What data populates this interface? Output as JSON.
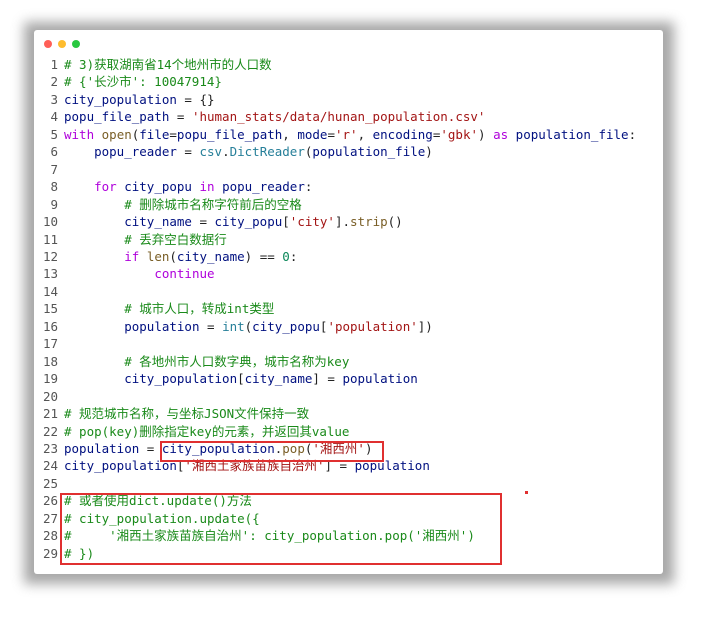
{
  "window": {
    "controls": [
      "close",
      "minimize",
      "maximize"
    ],
    "colors": {
      "close": "#ff5f57",
      "minimize": "#febc2e",
      "maximize": "#28c840"
    }
  },
  "code": {
    "lines": [
      {
        "num": "1",
        "tokens": [
          [
            "c",
            "# 3)获取湖南省14个地州市的人口数"
          ]
        ]
      },
      {
        "num": "2",
        "tokens": [
          [
            "c",
            "# {'长沙市': 10047914}"
          ]
        ]
      },
      {
        "num": "3",
        "tokens": [
          [
            "v",
            "city_population"
          ],
          [
            "p",
            " = {}"
          ]
        ]
      },
      {
        "num": "4",
        "tokens": [
          [
            "v",
            "popu_file_path"
          ],
          [
            "p",
            " = "
          ],
          [
            "s",
            "'human_stats/data/hunan_population.csv'"
          ]
        ]
      },
      {
        "num": "5",
        "tokens": [
          [
            "k",
            "with"
          ],
          [
            "p",
            " "
          ],
          [
            "f",
            "open"
          ],
          [
            "p",
            "("
          ],
          [
            "v",
            "file"
          ],
          [
            "p",
            "="
          ],
          [
            "v",
            "popu_file_path"
          ],
          [
            "p",
            ", "
          ],
          [
            "v",
            "mode"
          ],
          [
            "p",
            "="
          ],
          [
            "s",
            "'r'"
          ],
          [
            "p",
            ", "
          ],
          [
            "v",
            "encoding"
          ],
          [
            "p",
            "="
          ],
          [
            "s",
            "'gbk'"
          ],
          [
            "p",
            ") "
          ],
          [
            "k",
            "as"
          ],
          [
            "p",
            " "
          ],
          [
            "v",
            "population_file"
          ],
          [
            "p",
            ":"
          ]
        ]
      },
      {
        "num": "6",
        "tokens": [
          [
            "p",
            "    "
          ],
          [
            "v",
            "popu_reader"
          ],
          [
            "p",
            " = "
          ],
          [
            "t",
            "csv"
          ],
          [
            "p",
            "."
          ],
          [
            "t",
            "DictReader"
          ],
          [
            "p",
            "("
          ],
          [
            "v",
            "population_file"
          ],
          [
            "p",
            ")"
          ]
        ]
      },
      {
        "num": "7",
        "tokens": []
      },
      {
        "num": "8",
        "tokens": [
          [
            "p",
            "    "
          ],
          [
            "k",
            "for"
          ],
          [
            "p",
            " "
          ],
          [
            "v",
            "city_popu"
          ],
          [
            "p",
            " "
          ],
          [
            "k",
            "in"
          ],
          [
            "p",
            " "
          ],
          [
            "v",
            "popu_reader"
          ],
          [
            "p",
            ":"
          ]
        ]
      },
      {
        "num": "9",
        "tokens": [
          [
            "p",
            "        "
          ],
          [
            "c",
            "# 删除城市名称字符前后的空格"
          ]
        ]
      },
      {
        "num": "10",
        "tokens": [
          [
            "p",
            "        "
          ],
          [
            "v",
            "city_name"
          ],
          [
            "p",
            " = "
          ],
          [
            "v",
            "city_popu"
          ],
          [
            "p",
            "["
          ],
          [
            "s",
            "'city'"
          ],
          [
            "p",
            "]."
          ],
          [
            "f",
            "strip"
          ],
          [
            "p",
            "()"
          ]
        ]
      },
      {
        "num": "11",
        "tokens": [
          [
            "p",
            "        "
          ],
          [
            "c",
            "# 丢弃空白数据行"
          ]
        ]
      },
      {
        "num": "12",
        "tokens": [
          [
            "p",
            "        "
          ],
          [
            "k",
            "if"
          ],
          [
            "p",
            " "
          ],
          [
            "f",
            "len"
          ],
          [
            "p",
            "("
          ],
          [
            "v",
            "city_name"
          ],
          [
            "p",
            ") == "
          ],
          [
            "n",
            "0"
          ],
          [
            "p",
            ":"
          ]
        ]
      },
      {
        "num": "13",
        "tokens": [
          [
            "p",
            "            "
          ],
          [
            "k",
            "continue"
          ]
        ]
      },
      {
        "num": "14",
        "tokens": []
      },
      {
        "num": "15",
        "tokens": [
          [
            "p",
            "        "
          ],
          [
            "c",
            "# 城市人口，转成int类型"
          ]
        ]
      },
      {
        "num": "16",
        "tokens": [
          [
            "p",
            "        "
          ],
          [
            "v",
            "population"
          ],
          [
            "p",
            " = "
          ],
          [
            "t",
            "int"
          ],
          [
            "p",
            "("
          ],
          [
            "v",
            "city_popu"
          ],
          [
            "p",
            "["
          ],
          [
            "s",
            "'population'"
          ],
          [
            "p",
            "])"
          ]
        ]
      },
      {
        "num": "17",
        "tokens": []
      },
      {
        "num": "18",
        "tokens": [
          [
            "p",
            "        "
          ],
          [
            "c",
            "# 各地州市人口数字典，城市名称为key"
          ]
        ]
      },
      {
        "num": "19",
        "tokens": [
          [
            "p",
            "        "
          ],
          [
            "v",
            "city_population"
          ],
          [
            "p",
            "["
          ],
          [
            "v",
            "city_name"
          ],
          [
            "p",
            "] = "
          ],
          [
            "v",
            "population"
          ]
        ]
      },
      {
        "num": "20",
        "tokens": []
      },
      {
        "num": "21",
        "tokens": [
          [
            "c",
            "# 规范城市名称，与坐标JSON文件保持一致"
          ]
        ]
      },
      {
        "num": "22",
        "tokens": [
          [
            "c",
            "# pop(key)删除指定key的元素，并返回其value"
          ]
        ]
      },
      {
        "num": "23",
        "tokens": [
          [
            "v",
            "population"
          ],
          [
            "p",
            " = "
          ],
          [
            "v",
            "city_population"
          ],
          [
            "p",
            "."
          ],
          [
            "f",
            "pop"
          ],
          [
            "p",
            "("
          ],
          [
            "s",
            "'湘西州'"
          ],
          [
            "p",
            ")"
          ]
        ]
      },
      {
        "num": "24",
        "tokens": [
          [
            "v",
            "city_population"
          ],
          [
            "p",
            "["
          ],
          [
            "s",
            "'湘西土家族苗族自治州'"
          ],
          [
            "p",
            "] = "
          ],
          [
            "v",
            "population"
          ]
        ]
      },
      {
        "num": "25",
        "tokens": []
      },
      {
        "num": "26",
        "tokens": [
          [
            "c",
            "# 或者使用dict.update()方法"
          ]
        ]
      },
      {
        "num": "27",
        "tokens": [
          [
            "c",
            "# city_population.update({"
          ]
        ]
      },
      {
        "num": "28",
        "tokens": [
          [
            "c",
            "#     '湘西土家族苗族自治州': city_population.pop('湘西州')"
          ]
        ]
      },
      {
        "num": "29",
        "tokens": [
          [
            "c",
            "# })"
          ]
        ]
      }
    ]
  },
  "highlight_color": "#e03030"
}
